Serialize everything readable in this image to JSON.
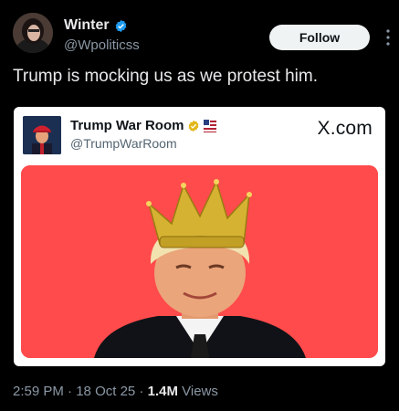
{
  "author": {
    "display_name": "Winter",
    "handle": "@Wpoliticss",
    "verified_icon": "verified-badge-icon"
  },
  "follow_label": "Follow",
  "tweet_text": "Trump is mocking us as we protest him.",
  "quoted": {
    "display_name": "Trump War Room",
    "handle": "@TrumpWarRoom",
    "site_label": "X.com"
  },
  "meta": {
    "time": "2:59 PM",
    "sep1": " · ",
    "date": "18 Oct 25",
    "sep2": " · ",
    "views_count": "1.4M",
    "views_label": " Views"
  },
  "colors": {
    "background": "#000000",
    "verified_blue": "#1d9bf0",
    "verified_gold": "#e2b719",
    "image_red": "#ff4b4b"
  }
}
